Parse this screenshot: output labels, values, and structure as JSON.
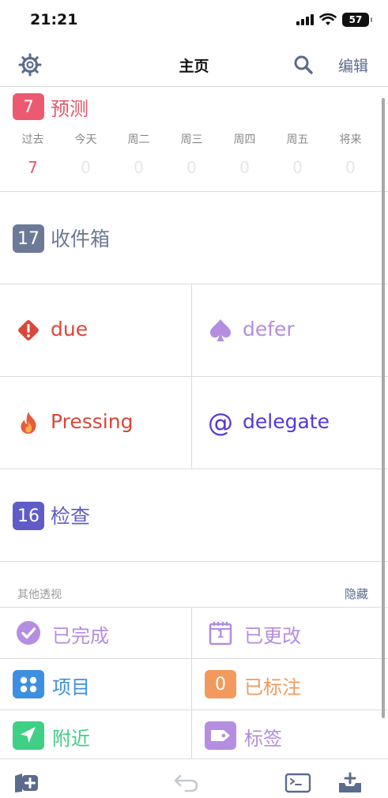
{
  "status": {
    "time": "21:21",
    "battery": "57"
  },
  "nav": {
    "title": "主页",
    "edit": "编辑"
  },
  "forecast": {
    "badge": "7",
    "label": "预测",
    "days": [
      {
        "name": "过去",
        "count": "7"
      },
      {
        "name": "今天",
        "count": "0"
      },
      {
        "name": "周二",
        "count": "0"
      },
      {
        "name": "周三",
        "count": "0"
      },
      {
        "name": "周四",
        "count": "0"
      },
      {
        "name": "周五",
        "count": "0"
      },
      {
        "name": "将来",
        "count": "0"
      }
    ]
  },
  "inbox": {
    "badge": "17",
    "label": "收件箱"
  },
  "tags": {
    "due": "due",
    "defer": "defer",
    "pressing": "Pressing",
    "delegate": "delegate"
  },
  "review": {
    "badge": "16",
    "label": "检查"
  },
  "others": {
    "title": "其他透视",
    "hide": "隐藏",
    "completed": "已完成",
    "changed": "已更改",
    "changed_icon_day": "1",
    "projects": "项目",
    "flagged_badge": "0",
    "flagged": "已标注",
    "nearby": "附近",
    "tags": "标签"
  },
  "colors": {
    "forecast": "#ec5a72",
    "inbox": "#6d7a96",
    "due": "#d9473a",
    "defer": "#b48ee0",
    "pressing": "#d9473a",
    "delegate": "#5836d6",
    "review": "#5f5cc7",
    "completed": "#b48ee0",
    "projects": "#3f8fe0",
    "flagged": "#f29a5d",
    "nearby": "#3fcf85",
    "tags": "#b48ee0",
    "accent": "#5a6b8c"
  }
}
